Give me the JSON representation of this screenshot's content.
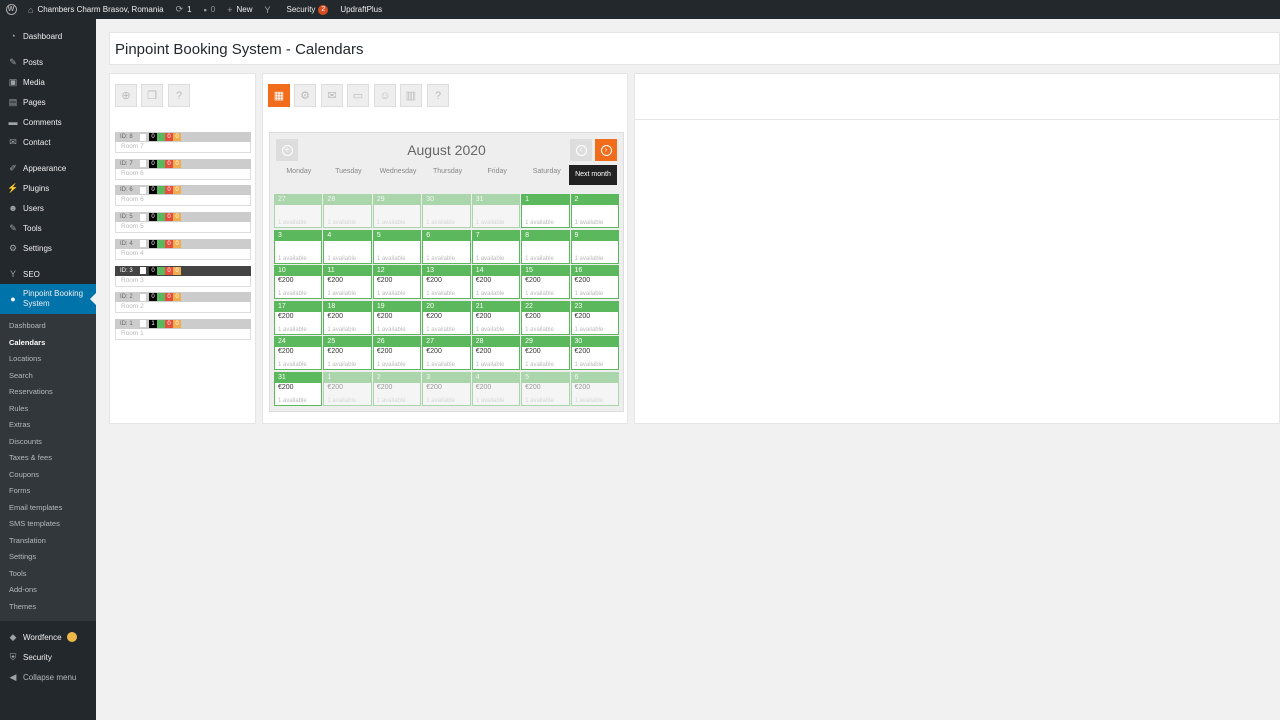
{
  "adminbar": {
    "site_name": "Chambers Charm Brasov, Romania",
    "updates_count": "1",
    "comments_count": "0",
    "new_label": "New",
    "security_label": "Security",
    "security_badge": "2",
    "updraft_label": "UpdraftPlus"
  },
  "sidebar": {
    "items_top": [
      {
        "label": "Dashboard",
        "icon": "dashboard-icon"
      },
      {
        "label": "Posts",
        "icon": "pin-icon"
      },
      {
        "label": "Media",
        "icon": "media-icon"
      },
      {
        "label": "Pages",
        "icon": "pages-icon"
      },
      {
        "label": "Comments",
        "icon": "comments-icon"
      },
      {
        "label": "Contact",
        "icon": "mail-icon"
      },
      {
        "label": "Appearance",
        "icon": "brush-icon"
      },
      {
        "label": "Plugins",
        "icon": "plugin-icon"
      },
      {
        "label": "Users",
        "icon": "users-icon"
      },
      {
        "label": "Tools",
        "icon": "wrench-icon"
      },
      {
        "label": "Settings",
        "icon": "settings-icon"
      },
      {
        "label": "SEO",
        "icon": "seo-icon"
      }
    ],
    "active_item": "Pinpoint Booking System",
    "submenu": [
      "Dashboard",
      "Calendars",
      "Locations",
      "Search",
      "Reservations",
      "Rules",
      "Extras",
      "Discounts",
      "Taxes & fees",
      "Coupons",
      "Forms",
      "Email templates",
      "SMS templates",
      "Translation",
      "Settings",
      "Tools",
      "Add-ons",
      "Themes"
    ],
    "current_sub": "Calendars",
    "items_bottom": [
      {
        "label": "Wordfence",
        "icon": "wordfence-icon"
      },
      {
        "label": "Security",
        "icon": "shield-icon"
      },
      {
        "label": "Collapse menu",
        "icon": "collapse-icon"
      }
    ]
  },
  "page": {
    "title": "Pinpoint Booking System - Calendars"
  },
  "calendars": [
    {
      "id": "ID: 8",
      "count": "0",
      "red": "0",
      "orange": "0",
      "room": "Room 7"
    },
    {
      "id": "ID: 7",
      "count": "0",
      "red": "0",
      "orange": "0",
      "room": "Room 6"
    },
    {
      "id": "ID: 6",
      "count": "0",
      "red": "0",
      "orange": "0",
      "room": "Room 6"
    },
    {
      "id": "ID: 5",
      "count": "0",
      "red": "0",
      "orange": "0",
      "room": "Room 5"
    },
    {
      "id": "ID: 4",
      "count": "0",
      "red": "0",
      "orange": "0",
      "room": "Room 4"
    },
    {
      "id": "ID: 3",
      "count": "0",
      "red": "0",
      "orange": "0",
      "room": "Room 3",
      "selected": true
    },
    {
      "id": "ID: 2",
      "count": "0",
      "red": "0",
      "orange": "0",
      "room": "Room 2"
    },
    {
      "id": "ID: 1",
      "count": "1",
      "red": "0",
      "orange": "0",
      "room": "Room 1"
    }
  ],
  "calendar": {
    "month": "August 2020",
    "tooltip": "Next month",
    "weekdays": [
      "Monday",
      "Tuesday",
      "Wednesday",
      "Thursday",
      "Friday",
      "Saturday",
      "Sunday"
    ],
    "available_text": "1 available",
    "weeks": [
      [
        {
          "d": "27",
          "o": true
        },
        {
          "d": "28",
          "o": true
        },
        {
          "d": "29",
          "o": true
        },
        {
          "d": "30",
          "o": true
        },
        {
          "d": "31",
          "o": true
        },
        {
          "d": "1"
        },
        {
          "d": "2"
        }
      ],
      [
        {
          "d": "3"
        },
        {
          "d": "4"
        },
        {
          "d": "5"
        },
        {
          "d": "6"
        },
        {
          "d": "7"
        },
        {
          "d": "8"
        },
        {
          "d": "9"
        }
      ],
      [
        {
          "d": "10",
          "p": "€200"
        },
        {
          "d": "11",
          "p": "€200"
        },
        {
          "d": "12",
          "p": "€200"
        },
        {
          "d": "13",
          "p": "€200"
        },
        {
          "d": "14",
          "p": "€200"
        },
        {
          "d": "15",
          "p": "€200"
        },
        {
          "d": "16",
          "p": "€200"
        }
      ],
      [
        {
          "d": "17",
          "p": "€200"
        },
        {
          "d": "18",
          "p": "€200"
        },
        {
          "d": "19",
          "p": "€200"
        },
        {
          "d": "20",
          "p": "€200"
        },
        {
          "d": "21",
          "p": "€200"
        },
        {
          "d": "22",
          "p": "€200"
        },
        {
          "d": "23",
          "p": "€200"
        }
      ],
      [
        {
          "d": "24",
          "p": "€200"
        },
        {
          "d": "25",
          "p": "€200"
        },
        {
          "d": "26",
          "p": "€200"
        },
        {
          "d": "27",
          "p": "€200"
        },
        {
          "d": "28",
          "p": "€200"
        },
        {
          "d": "29",
          "p": "€200"
        },
        {
          "d": "30",
          "p": "€200"
        }
      ],
      [
        {
          "d": "31",
          "p": "€200"
        },
        {
          "d": "1",
          "p": "€200",
          "o": true
        },
        {
          "d": "2",
          "p": "€200",
          "o": true
        },
        {
          "d": "3",
          "p": "€200",
          "o": true
        },
        {
          "d": "4",
          "p": "€200",
          "o": true
        },
        {
          "d": "5",
          "p": "€200",
          "o": true
        },
        {
          "d": "6",
          "p": "€200",
          "o": true
        }
      ]
    ]
  },
  "colors": {
    "accent": "#f16d1c",
    "available": "#5cb85c",
    "wp_blue": "#0073aa",
    "adminbar": "#23282d"
  }
}
